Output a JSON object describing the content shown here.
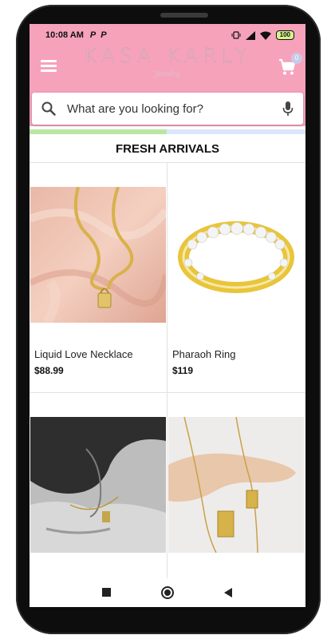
{
  "status_bar": {
    "time": "10:08 AM",
    "app_icon_1": "P",
    "app_icon_2": "P",
    "battery": "100"
  },
  "header": {
    "brand": "KASA KARLY",
    "brand_sub": "Jewelry",
    "cart_count": "0",
    "background": "#f6a2bb"
  },
  "search": {
    "placeholder": "What are you looking for?"
  },
  "section": {
    "title": "FRESH ARRIVALS"
  },
  "products": [
    {
      "name": "Liquid Love Necklace",
      "price": "$88.99",
      "image": "gold-chain-lock-pendant-on-pink-silk"
    },
    {
      "name": "Pharaoh Ring",
      "price": "$119",
      "image": "gold-eternity-ring-with-diamonds"
    },
    {
      "name": "",
      "price": "",
      "image": "black-and-white-model-wearing-pendant"
    },
    {
      "name": "",
      "price": "",
      "image": "hand-holding-gold-tag-necklaces"
    }
  ],
  "nav": {
    "recents": "recents-square-icon",
    "home": "home-circle-icon",
    "back": "back-triangle-icon"
  }
}
